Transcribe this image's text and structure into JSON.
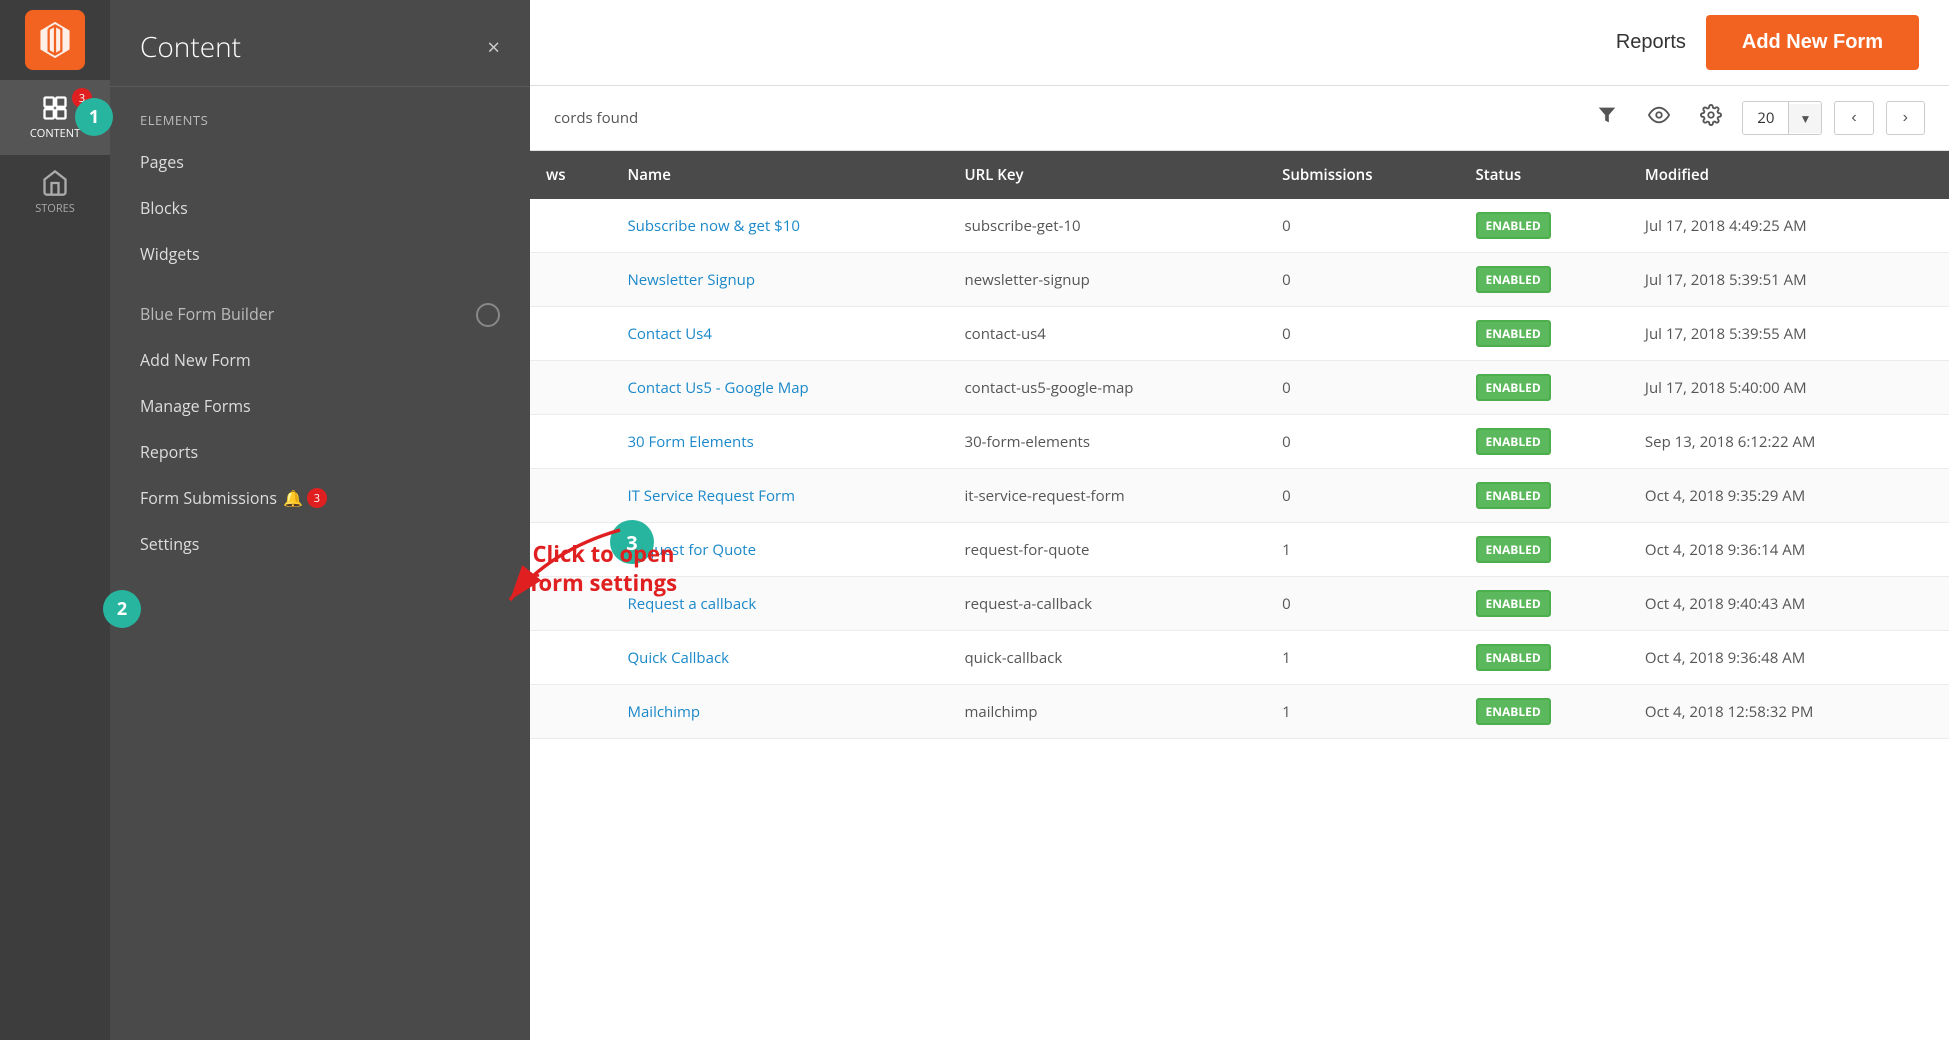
{
  "iconBar": {
    "logoAlt": "Magento Logo",
    "items": [
      {
        "id": "content",
        "label": "CONTENT",
        "active": true,
        "badge": 3
      },
      {
        "id": "stores",
        "label": "STORES",
        "active": false,
        "badge": null
      }
    ]
  },
  "sidebar": {
    "title": "Content",
    "closeLabel": "×",
    "elements": {
      "sectionLabel": "Elements",
      "items": [
        "Pages",
        "Blocks",
        "Widgets"
      ]
    },
    "blueFormBuilder": {
      "sectionLabel": "Blue Form Builder",
      "items": [
        {
          "label": "Add New Form",
          "hasBadge": false
        },
        {
          "label": "Manage Forms",
          "hasBadge": false
        },
        {
          "label": "Reports",
          "hasBadge": false
        },
        {
          "label": "Form Submissions",
          "hasBadge": true,
          "badgeCount": 3
        },
        {
          "label": "Settings",
          "hasBadge": false
        }
      ]
    }
  },
  "topBar": {
    "reportsLabel": "Reports",
    "addNewFormLabel": "Add New Form"
  },
  "recordsBar": {
    "recordsText": "cords found",
    "perPage": "20",
    "filterIcon": "▼",
    "visibilityIcon": "👁",
    "settingsIcon": "⚙"
  },
  "table": {
    "columns": [
      "ws",
      "Name",
      "URL Key",
      "Submissions",
      "Status",
      "Modified"
    ],
    "rows": [
      {
        "name": "Subscribe now & get $10",
        "urlKey": "subscribe-get-10",
        "submissions": "0",
        "status": "ENABLED",
        "modified": "Jul 17, 2018 4:49:25 AM"
      },
      {
        "name": "Newsletter Signup",
        "urlKey": "newsletter-signup",
        "submissions": "0",
        "status": "ENABLED",
        "modified": "Jul 17, 2018 5:39:51 AM"
      },
      {
        "name": "Contact Us4",
        "urlKey": "contact-us4",
        "submissions": "0",
        "status": "ENABLED",
        "modified": "Jul 17, 2018 5:39:55 AM"
      },
      {
        "name": "Contact Us5 - Google Map",
        "urlKey": "contact-us5-google-map",
        "submissions": "0",
        "status": "ENABLED",
        "modified": "Jul 17, 2018 5:40:00 AM"
      },
      {
        "name": "30 Form Elements",
        "urlKey": "30-form-elements",
        "submissions": "0",
        "status": "ENABLED",
        "modified": "Sep 13, 2018 6:12:22 AM"
      },
      {
        "name": "IT Service Request Form",
        "urlKey": "it-service-request-form",
        "submissions": "0",
        "status": "ENABLED",
        "modified": "Oct 4, 2018 9:35:29 AM"
      },
      {
        "name": "Request for Quote",
        "urlKey": "request-for-quote",
        "submissions": "1",
        "status": "ENABLED",
        "modified": "Oct 4, 2018 9:36:14 AM"
      },
      {
        "name": "Request a callback",
        "urlKey": "request-a-callback",
        "submissions": "0",
        "status": "ENABLED",
        "modified": "Oct 4, 2018 9:40:43 AM"
      },
      {
        "name": "Quick Callback",
        "urlKey": "quick-callback",
        "submissions": "1",
        "status": "ENABLED",
        "modified": "Oct 4, 2018 9:36:48 AM"
      },
      {
        "name": "Mailchimp",
        "urlKey": "mailchimp",
        "submissions": "1",
        "status": "ENABLED",
        "modified": "Oct 4, 2018 12:58:32 PM"
      }
    ]
  },
  "annotations": {
    "step1": "1",
    "step2": "2",
    "step3": "3",
    "clickText": "Click to open\nform settings",
    "arrowColor": "#e02020"
  }
}
